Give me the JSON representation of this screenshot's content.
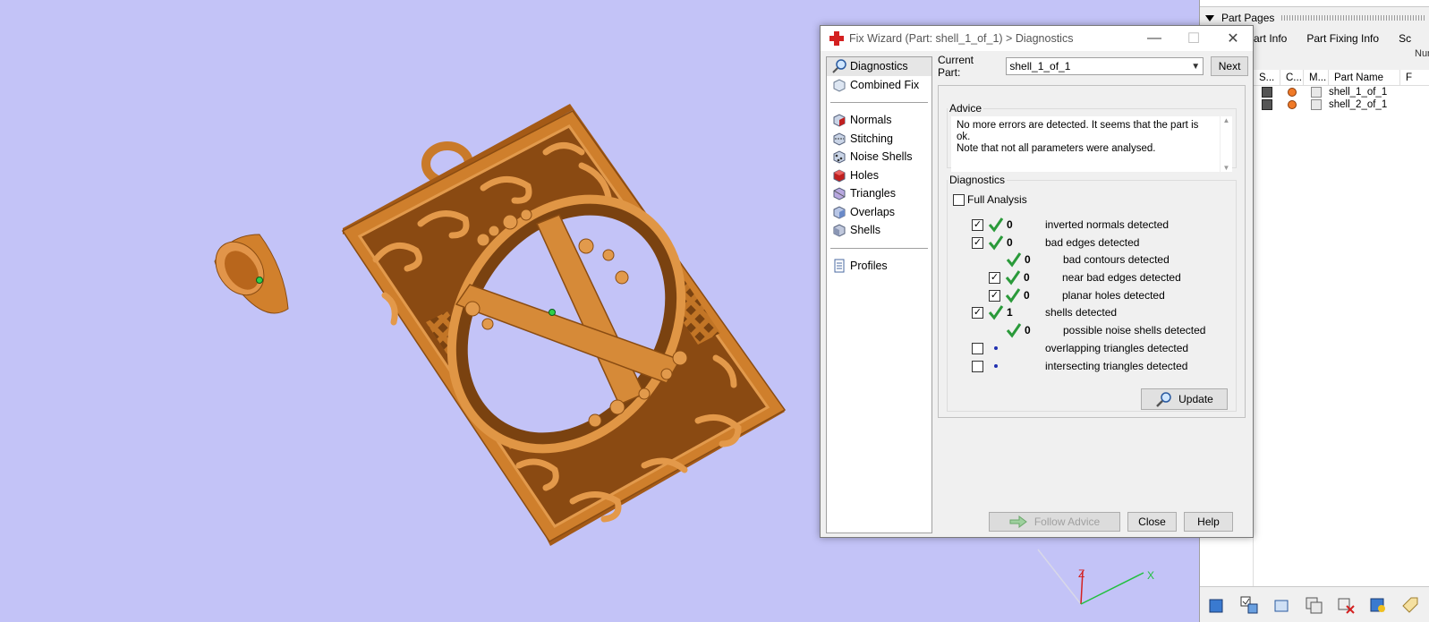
{
  "dialog": {
    "title": "Fix Wizard (Part: shell_1_of_1) > Diagnostics",
    "nav_items": [
      {
        "label": "Diagnostics",
        "icon": "magnifier-icon"
      },
      {
        "label": "Combined Fix",
        "icon": "combined-fix-icon"
      },
      {
        "label": "Normals",
        "icon": "normals-cube-icon"
      },
      {
        "label": "Stitching",
        "icon": "stitching-cube-icon"
      },
      {
        "label": "Noise Shells",
        "icon": "noise-shells-cube-icon"
      },
      {
        "label": "Holes",
        "icon": "holes-cube-icon"
      },
      {
        "label": "Triangles",
        "icon": "triangles-cube-icon"
      },
      {
        "label": "Overlaps",
        "icon": "overlaps-cube-icon"
      },
      {
        "label": "Shells",
        "icon": "shells-cube-icon"
      },
      {
        "label": "Profiles",
        "icon": "profiles-document-icon"
      }
    ],
    "current_part_label": "Current Part:",
    "current_part_value": "shell_1_of_1",
    "next_label": "Next",
    "advice": {
      "legend": "Advice",
      "text_line1": "No more errors are detected. It seems that the part is ok.",
      "text_line2": "Note that not all parameters were analysed."
    },
    "diagnostics": {
      "legend": "Diagnostics",
      "full_analysis_label": "Full Analysis",
      "rows": [
        {
          "checked": true,
          "status": "ok",
          "count": "0",
          "label": "inverted normals detected"
        },
        {
          "checked": true,
          "status": "ok",
          "count": "0",
          "label": "bad edges detected"
        },
        {
          "checked": null,
          "status": "ok",
          "count": "0",
          "label": "bad contours detected"
        },
        {
          "checked": true,
          "status": "ok",
          "count": "0",
          "label": "near bad edges detected"
        },
        {
          "checked": true,
          "status": "ok",
          "count": "0",
          "label": "planar holes detected"
        },
        {
          "checked": true,
          "status": "ok",
          "count": "1",
          "label": "shells detected"
        },
        {
          "checked": null,
          "status": "ok",
          "count": "0",
          "label": "possible noise shells detected"
        },
        {
          "checked": false,
          "status": "none",
          "count": "",
          "label": "overlapping triangles detected"
        },
        {
          "checked": false,
          "status": "none",
          "count": "",
          "label": "intersecting triangles detected"
        }
      ],
      "update_label": "Update"
    },
    "follow_advice_label": "Follow Advice",
    "close_label": "Close",
    "help_label": "Help"
  },
  "side_panel": {
    "pages_title": "Part Pages",
    "tabs": [
      "art Info",
      "Part Fixing Info",
      "Sc"
    ],
    "num_label": "Num",
    "columns": [
      "S...",
      "C...",
      "M...",
      "Part Name",
      "F"
    ],
    "parts": [
      {
        "name": "shell_1_of_1"
      },
      {
        "name": "shell_2_of_1"
      }
    ]
  },
  "viewport": {
    "axis_labels": {
      "z": "Z",
      "x": "X"
    },
    "model_color": "#d9862c"
  }
}
